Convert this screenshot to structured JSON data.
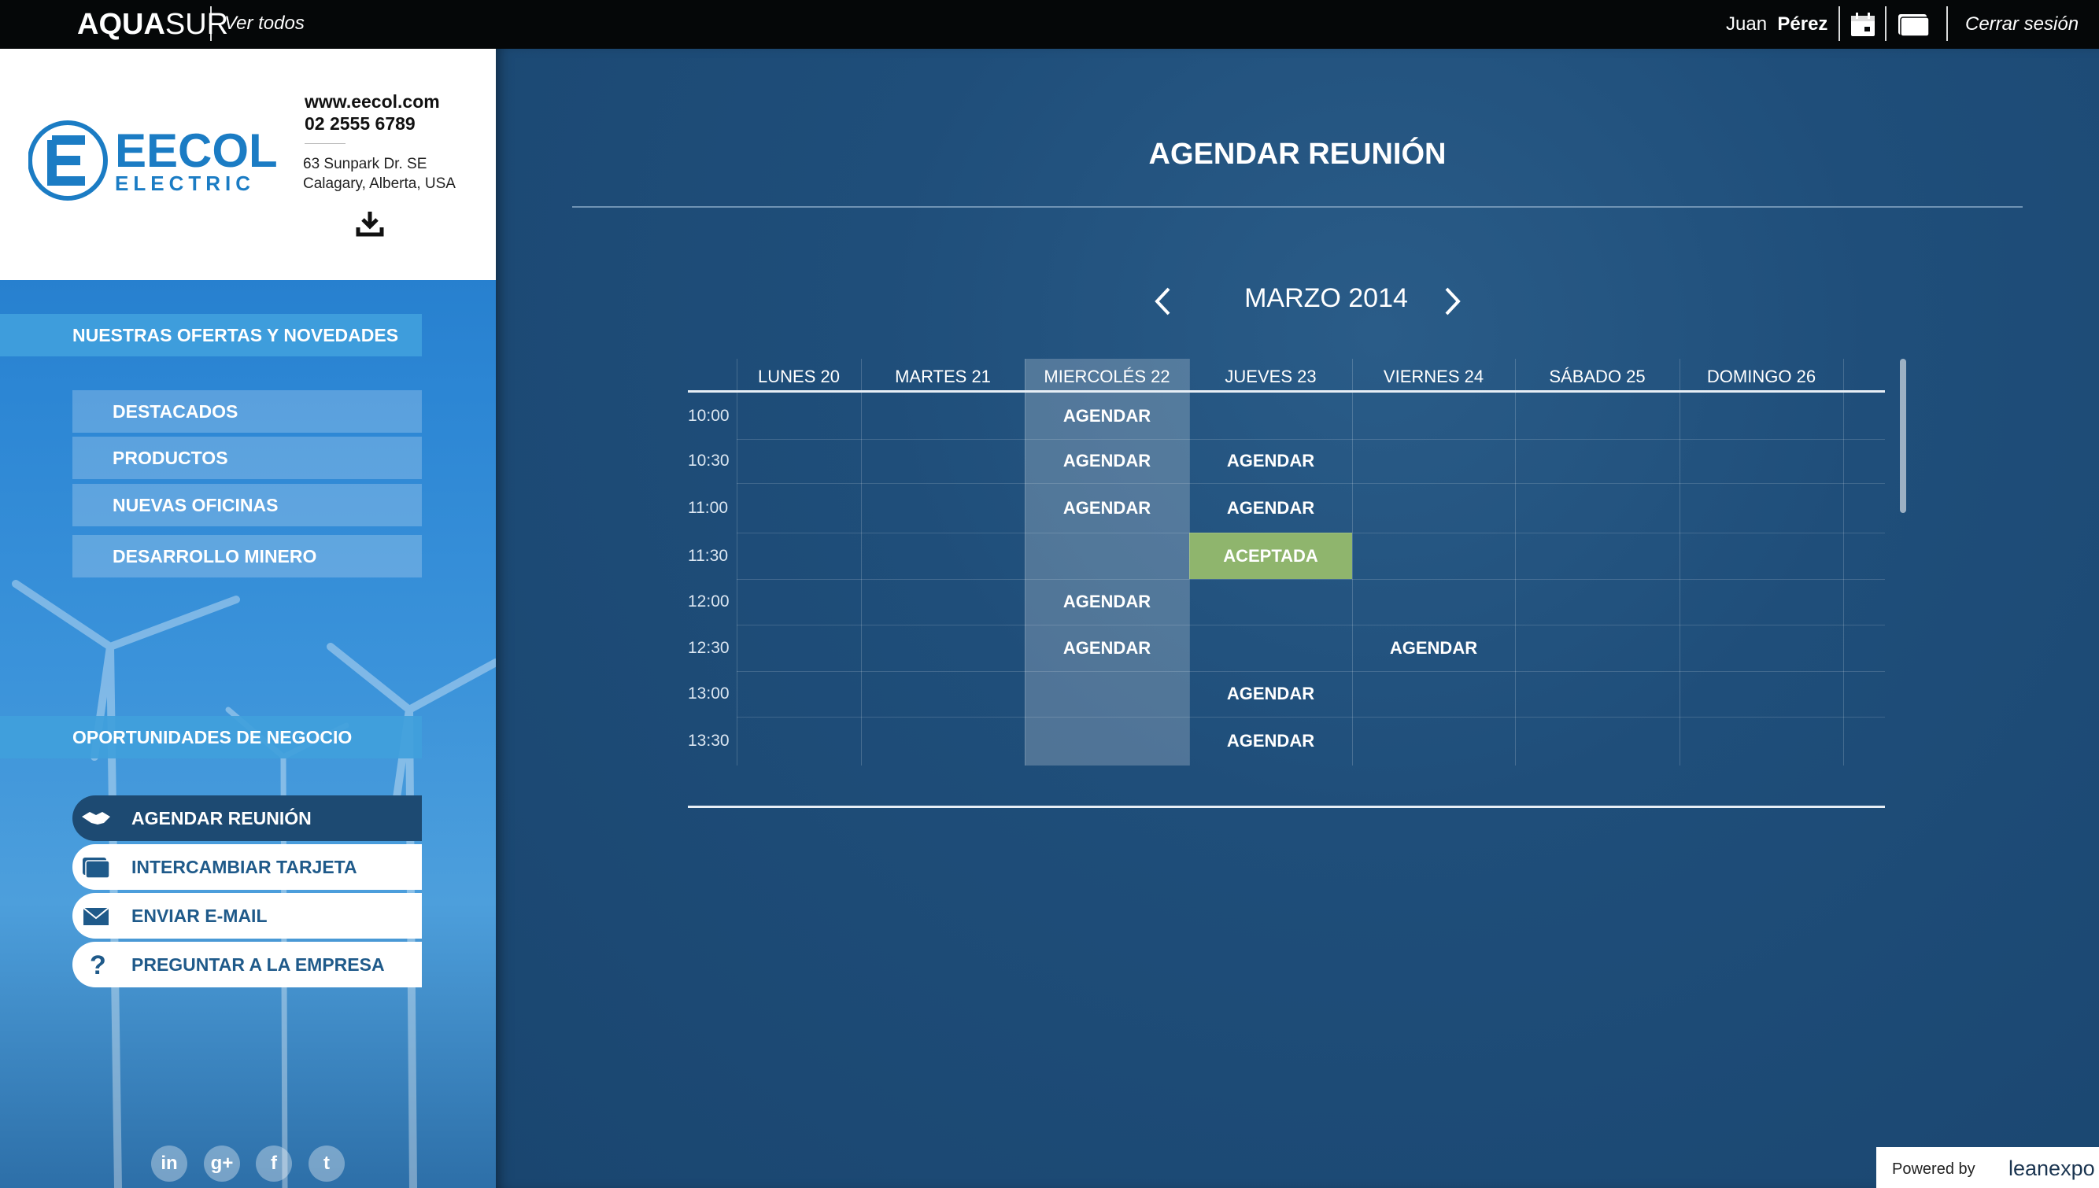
{
  "topbar": {
    "brand_bold": "AQUA",
    "brand_light": "SUR",
    "view_all": "Ver todos",
    "user_first": "Juan",
    "user_last": "Pérez",
    "logout": "Cerrar sesión"
  },
  "company": {
    "logo_name": "EECOL",
    "logo_sub": "ELECTRIC",
    "website": "www.eecol.com",
    "phone": "02 2555 6789",
    "address_line1": "63 Sunpark Dr. SE",
    "address_line2": "Calagary, Alberta, USA"
  },
  "sidebar": {
    "offers_header": "NUESTRAS OFERTAS Y NOVEDADES",
    "offers": [
      {
        "label": "DESTACADOS"
      },
      {
        "label": "PRODUCTOS"
      },
      {
        "label": "NUEVAS OFICINAS"
      },
      {
        "label": "DESARROLLO MINERO"
      }
    ],
    "business_header": "OPORTUNIDADES DE NEGOCIO",
    "actions": [
      {
        "label": "AGENDAR REUNIÓN",
        "icon": "handshake-icon",
        "active": true
      },
      {
        "label": "INTERCAMBIAR TARJETA",
        "icon": "card-icon",
        "active": false
      },
      {
        "label": "ENVIAR E-MAIL",
        "icon": "envelope-icon",
        "active": false
      },
      {
        "label": "PREGUNTAR A LA EMPRESA",
        "icon": "question-icon",
        "active": false
      }
    ],
    "social": [
      {
        "label": "in",
        "icon": "linkedin-icon"
      },
      {
        "label": "g+",
        "icon": "google-plus-icon"
      },
      {
        "label": "f",
        "icon": "facebook-icon"
      },
      {
        "label": "t",
        "icon": "twitter-icon"
      }
    ]
  },
  "main": {
    "title": "AGENDAR REUNIÓN",
    "month": "MARZO 2014",
    "days": [
      "LUNES 20",
      "MARTES 21",
      "MIERCOLÉS 22",
      "JUEVES 23",
      "VIERNES 24",
      "SÁBADO 25",
      "DOMINGO 26"
    ],
    "selected_day_index": 2,
    "slots": [
      {
        "time": "10:00",
        "cells": [
          "",
          "",
          "AGENDAR",
          "",
          "",
          "",
          ""
        ]
      },
      {
        "time": "10:30",
        "cells": [
          "",
          "",
          "AGENDAR",
          "AGENDAR",
          "",
          "",
          ""
        ]
      },
      {
        "time": "11:00",
        "cells": [
          "",
          "",
          "AGENDAR",
          "AGENDAR",
          "",
          "",
          ""
        ]
      },
      {
        "time": "11:30",
        "cells": [
          "",
          "",
          "",
          "ACEPTADA",
          "",
          "",
          ""
        ]
      },
      {
        "time": "12:00",
        "cells": [
          "",
          "",
          "AGENDAR",
          "",
          "",
          "",
          ""
        ]
      },
      {
        "time": "12:30",
        "cells": [
          "",
          "",
          "AGENDAR",
          "",
          "AGENDAR",
          "",
          ""
        ]
      },
      {
        "time": "13:00",
        "cells": [
          "",
          "",
          "",
          "AGENDAR",
          "",
          "",
          ""
        ]
      },
      {
        "time": "13:30",
        "cells": [
          "",
          "",
          "",
          "AGENDAR",
          "",
          "",
          ""
        ]
      }
    ],
    "accepted_label": "ACEPTADA",
    "accepted_color": "#8fb56d"
  },
  "footer": {
    "powered_by": "Powered by",
    "powered_brand": "leanexpo"
  },
  "colors": {
    "topbar": "#050708",
    "main_bg": "#1d4a72",
    "accent_blue": "#1f5a8a",
    "sidebar_header": "#40a0dc"
  }
}
